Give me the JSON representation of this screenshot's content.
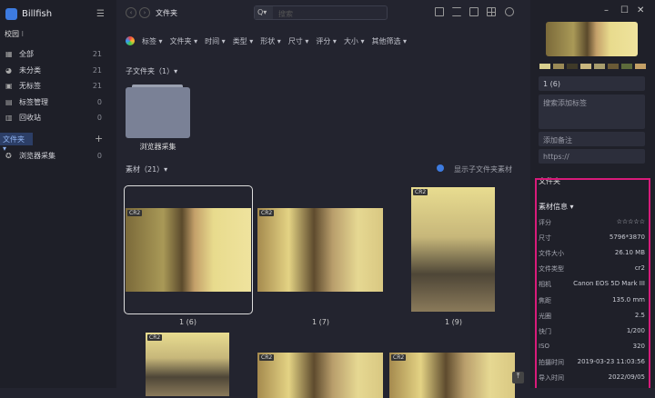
{
  "app": {
    "name": "Billfish",
    "library": "校园 ⁝"
  },
  "sidebar": {
    "items": [
      {
        "icon": "grid-icon",
        "label": "全部",
        "count": "21"
      },
      {
        "icon": "pie-icon",
        "label": "未分类",
        "count": "21"
      },
      {
        "icon": "tag-off-icon",
        "label": "无标签",
        "count": "21"
      },
      {
        "icon": "tag-manage-icon",
        "label": "标签管理",
        "count": "0"
      },
      {
        "icon": "trash-icon",
        "label": "回收站",
        "count": "0"
      }
    ],
    "folders_header": "文件夹 ▾",
    "add": "+",
    "folders": [
      {
        "label": "浏览器采集",
        "count": "0"
      }
    ]
  },
  "toolbar": {
    "title": "文件夹",
    "search_placeholder": "搜索",
    "search_mode": "Q▾"
  },
  "filters": [
    "标签 ▾",
    "文件夹 ▾",
    "时间 ▾",
    "类型 ▾",
    "形状 ▾",
    "尺寸 ▾",
    "评分  ▾",
    "大小 ▾",
    "其他筛选 ▾"
  ],
  "subfolders": {
    "header": "子文件夹（1）▾",
    "items": [
      {
        "name": "浏览器采集"
      }
    ]
  },
  "materials": {
    "header": "素材（21）▾",
    "show_sub": "显示子文件夹素材",
    "items": [
      {
        "badge": "CR2",
        "name": "1 (6)"
      },
      {
        "badge": "CR2",
        "name": "1 (7)"
      },
      {
        "badge": "CR2",
        "name": "1 (9)"
      },
      {
        "badge": "CR2",
        "name": ""
      },
      {
        "badge": "CR2",
        "name": ""
      },
      {
        "badge": "CR2",
        "name": ""
      }
    ]
  },
  "inspector": {
    "swatches": [
      "#d9cf8e",
      "#9b8a56",
      "#3f3a28",
      "#c9b77f",
      "#a99e6e",
      "#6a5a36",
      "#5d6b3b",
      "#c4a066"
    ],
    "name": "1 (6)",
    "tags_placeholder": "搜索添加标签",
    "note_placeholder": "添加备注",
    "url_placeholder": "https://",
    "folder_section": "文件夹",
    "info_header": "素材信息 ▾",
    "info": [
      {
        "k": "评分",
        "v": "☆☆☆☆☆"
      },
      {
        "k": "尺寸",
        "v": "5796*3870"
      },
      {
        "k": "文件大小",
        "v": "26.10 MB"
      },
      {
        "k": "文件类型",
        "v": "cr2"
      },
      {
        "k": "相机",
        "v": "Canon EOS 5D Mark III"
      },
      {
        "k": "焦距",
        "v": "135.0 mm"
      },
      {
        "k": "光圈",
        "v": "2.5"
      },
      {
        "k": "快门",
        "v": "1/200"
      },
      {
        "k": "ISO",
        "v": "320"
      },
      {
        "k": "拍摄时间",
        "v": "2019-03-23 11:03:56"
      },
      {
        "k": "导入时间",
        "v": "2022/09/05"
      }
    ]
  }
}
